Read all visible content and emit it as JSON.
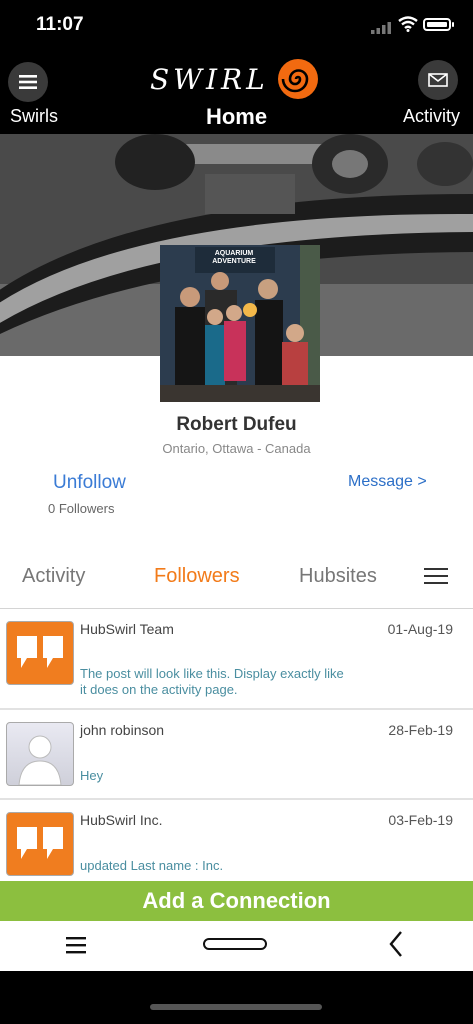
{
  "status_bar": {
    "time": "11:07"
  },
  "header": {
    "logo_text": "SWIRL",
    "left_label": "Swirls",
    "title": "Home",
    "right_label": "Activity"
  },
  "profile": {
    "name": "Robert Dufeu",
    "location": "Ontario, Ottawa - Canada",
    "unfollow_label": "Unfollow",
    "followers_count": "0 Followers",
    "message_label": "Message >",
    "photo_sign": "AQUARIUM ADVENTURE"
  },
  "tabs": [
    {
      "label": "Activity",
      "active": false
    },
    {
      "label": "Followers",
      "active": true
    },
    {
      "label": "Hubsites",
      "active": false
    }
  ],
  "list": [
    {
      "name": "HubSwirl Team",
      "date": "01-Aug-19",
      "message": "The post will look like this. Display exactly like it does on the activity page.",
      "avatar": "quote-icon"
    },
    {
      "name": "john robinson",
      "date": "28-Feb-19",
      "message": "Hey",
      "avatar": "person-icon"
    },
    {
      "name": "HubSwirl Inc.",
      "date": "03-Feb-19",
      "message": "updated Last name : Inc.",
      "avatar": "quote-icon"
    }
  ],
  "add_connection_label": "Add a Connection",
  "colors": {
    "accent": "#f27b1a",
    "link": "#3a7bd5",
    "add_bar": "#8cbf3f"
  }
}
